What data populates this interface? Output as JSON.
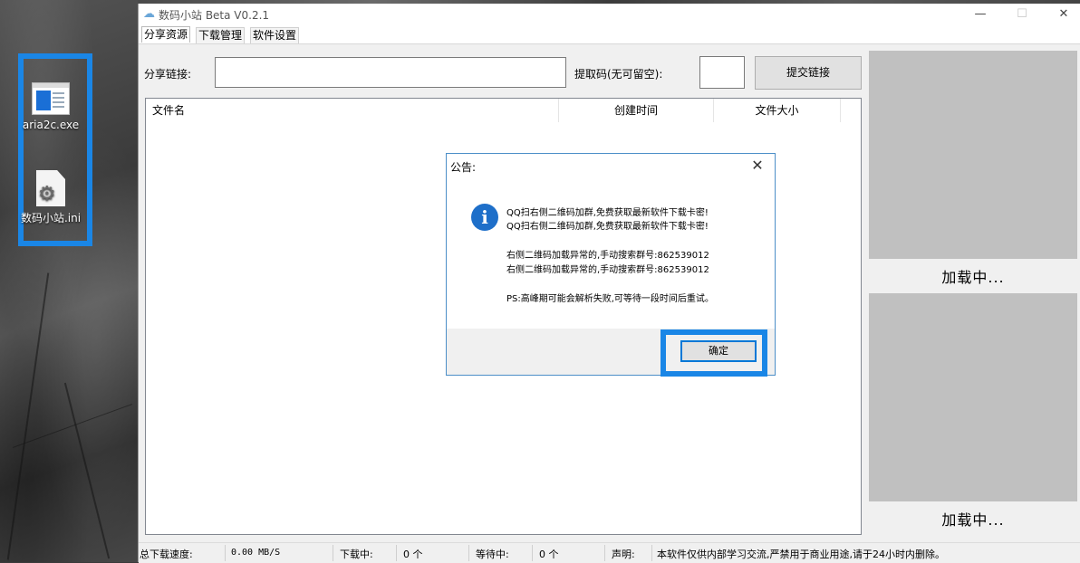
{
  "desktop": {
    "icons": [
      {
        "label": "aria2c.exe",
        "icon": "exe-file-icon"
      },
      {
        "label": "数码小站.ini",
        "icon": "ini-settings-file-icon"
      }
    ],
    "highlight_color": "#1a86e6"
  },
  "window": {
    "title": "数码小站 Beta V0.2.1",
    "controls": {
      "minimize": "—",
      "maximize": "☐",
      "close": "✕"
    }
  },
  "menu": {
    "items": [
      "分享资源",
      "下载管理",
      "软件设置"
    ]
  },
  "share": {
    "link_label": "分享链接:",
    "link_value": "",
    "code_label": "提取码(无可留空):",
    "code_value": "",
    "submit_label": "提交链接"
  },
  "file_list": {
    "columns": [
      "文件名",
      "创建时间",
      "文件大小"
    ],
    "rows": []
  },
  "qr_panels": [
    {
      "status": "加载中..."
    },
    {
      "status": "加载中..."
    }
  ],
  "status_bar": {
    "speed_label": "总下载速度:",
    "speed_value": "0.00 MB/S",
    "downloading_label": "下载中:",
    "downloading_value": "0 个",
    "waiting_label": "等待中:",
    "waiting_value": "0 个",
    "notice_label": "声明:",
    "notice_text": "本软件仅供内部学习交流,严禁用于商业用途,请于24小时内删除。"
  },
  "dialog": {
    "title": "公告:",
    "close": "✕",
    "icon": "info-icon",
    "lines": [
      "QQ扫右侧二维码加群,免费获取最新软件下载卡密!",
      "QQ扫右侧二维码加群,免费获取最新软件下载卡密!",
      "右侧二维码加载异常的,手动搜索群号:862539012",
      "右侧二维码加载异常的,手动搜索群号:862539012",
      "PS:高峰期可能会解析失败,可等待一段时间后重试。"
    ],
    "ok_label": "确定"
  }
}
